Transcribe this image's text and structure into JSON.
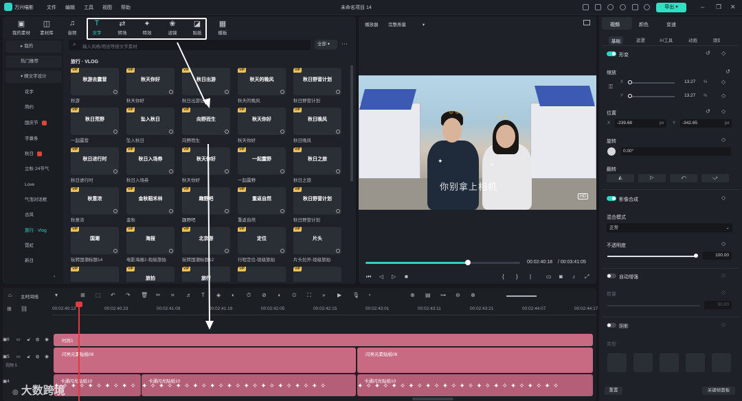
{
  "app": {
    "title": "万兴喵影",
    "project": "未命名项目 14",
    "menu": [
      "文件",
      "编辑",
      "工具",
      "视图",
      "帮助"
    ],
    "export_label": "导出"
  },
  "media_tabs": [
    {
      "label": "我的素材",
      "icon": "folder-icon"
    },
    {
      "label": "素材库",
      "icon": "library-icon"
    },
    {
      "label": "音频",
      "icon": "music-icon"
    },
    {
      "label": "文字",
      "icon": "text-icon"
    },
    {
      "label": "转场",
      "icon": "transition-icon"
    },
    {
      "label": "特效",
      "icon": "effects-icon"
    },
    {
      "label": "滤镜",
      "icon": "filter-icon"
    },
    {
      "label": "贴纸",
      "icon": "sticker-icon"
    },
    {
      "label": "模板",
      "icon": "template-icon"
    }
  ],
  "sidebar": {
    "items": [
      "我的",
      "热门推荐",
      "精文字设计",
      "花字",
      "简约",
      "国庆节",
      "字幕条",
      "秋日",
      "立秋·24节气",
      "Love",
      "气泡对话框",
      "古风",
      "旅行 · Vlog",
      "霓虹",
      "新日"
    ]
  },
  "search": {
    "placeholder": "输入风格/用途等搜文字素材",
    "filter": "全部"
  },
  "section_title": "旅行 · VLOG",
  "cards": [
    {
      "title": "秋游",
      "art": "秋游去露营"
    },
    {
      "title": "秋天你好",
      "art": "秋天你好"
    },
    {
      "title": "秋日出游记",
      "art": "秋日出游"
    },
    {
      "title": "秋天的晚风",
      "art": "秋天的晚风"
    },
    {
      "title": "秋日野营计划",
      "art": "秋日野营计划"
    },
    {
      "title": "一起露营",
      "art": "秋日荒野"
    },
    {
      "title": "坠入秋日",
      "art": "坠入秋日"
    },
    {
      "title": "向野而生",
      "art": "向野而生"
    },
    {
      "title": "秋天你好",
      "art": "秋天你好"
    },
    {
      "title": "秋日晚风",
      "art": "秋日晚风"
    },
    {
      "title": "秋日进行时",
      "art": "秋日进行时"
    },
    {
      "title": "秋日入场券",
      "art": "秋日入场券"
    },
    {
      "title": "秋天你好",
      "art": "秋天你好"
    },
    {
      "title": "一起露野",
      "art": "一起露野"
    },
    {
      "title": "秋日之旅",
      "art": "秋日之旅"
    },
    {
      "title": "秋意浓",
      "art": "秋意浓"
    },
    {
      "title": "金秋",
      "art": "金秋稻禾林"
    },
    {
      "title": "趣野吧",
      "art": "趣野吧"
    },
    {
      "title": "重返自然",
      "art": "重返自然"
    },
    {
      "title": "秋日野营计划",
      "art": "秋日野营计划"
    },
    {
      "title": "玩转国潮标题14",
      "art": "国潮"
    },
    {
      "title": "电影海报2-现级旅拍",
      "art": "海报"
    },
    {
      "title": "玩转国潮标题12",
      "art": "北京游"
    },
    {
      "title": "行程定位-现级旅拍",
      "art": "定位"
    },
    {
      "title": "片头拉开-现级旅拍",
      "art": "片头"
    },
    {
      "title": "",
      "art": ""
    },
    {
      "title": "",
      "art": "旅拍"
    },
    {
      "title": "",
      "art": "旅行"
    },
    {
      "title": "",
      "art": ""
    },
    {
      "title": "",
      "art": ""
    }
  ],
  "preview": {
    "player_label": "播放器",
    "quality": "完整质量",
    "current": "00:02:40:18",
    "total": "00:03:41:05",
    "progress": 0.66,
    "overlay_text": "你别拿上相机",
    "hd": "HD"
  },
  "timeline": {
    "label": "主时间线",
    "ticks": [
      "00:02:40:13",
      "00:02:40:23",
      "00:02:41:09",
      "00:02:41:19",
      "00:02:42:05",
      "00:02:42:15",
      "00:02:43:01",
      "00:02:43:11",
      "00:02:43:21",
      "00:02:44:07",
      "00:02:44:17"
    ],
    "tracks": [
      {
        "num": "6",
        "clips": [
          "时尚1"
        ]
      },
      {
        "num": "5",
        "sub": "视频 5",
        "clips": [
          "闪亮元素贴纸08",
          "闪亮元素贴纸08"
        ]
      },
      {
        "num": "4",
        "clips": [
          "卡通闪光贴纸10",
          "卡通闪光贴纸10",
          "卡通闪光贴纸10"
        ]
      }
    ]
  },
  "watermark": "大数跨境",
  "inspector": {
    "tabs": [
      "视频",
      "颜色",
      "变速"
    ],
    "subtabs": [
      "基础",
      "遮罩",
      "AI工具",
      "动画",
      "跟踪"
    ],
    "transform": "形变",
    "scale": "缩放",
    "scale_x": "13.27",
    "scale_y": "13.27",
    "pct": "%",
    "position": "位置",
    "pos_x": "-239.68",
    "pos_y": "-342.65",
    "px": "px",
    "rotate": "旋转",
    "rotate_val": "0.00°",
    "flip": "翻转",
    "compositing": "影像合成",
    "blend_label": "混合模式",
    "blend_value": "正常",
    "opacity_label": "不透明度",
    "opacity_value": "100.00",
    "auto_enhance": "自动增强",
    "amount": "数量",
    "amount_value": "50.00",
    "shadow": "阴影",
    "type": "类型",
    "reset": "重置",
    "keyframe_panel": "关键帧面板"
  }
}
